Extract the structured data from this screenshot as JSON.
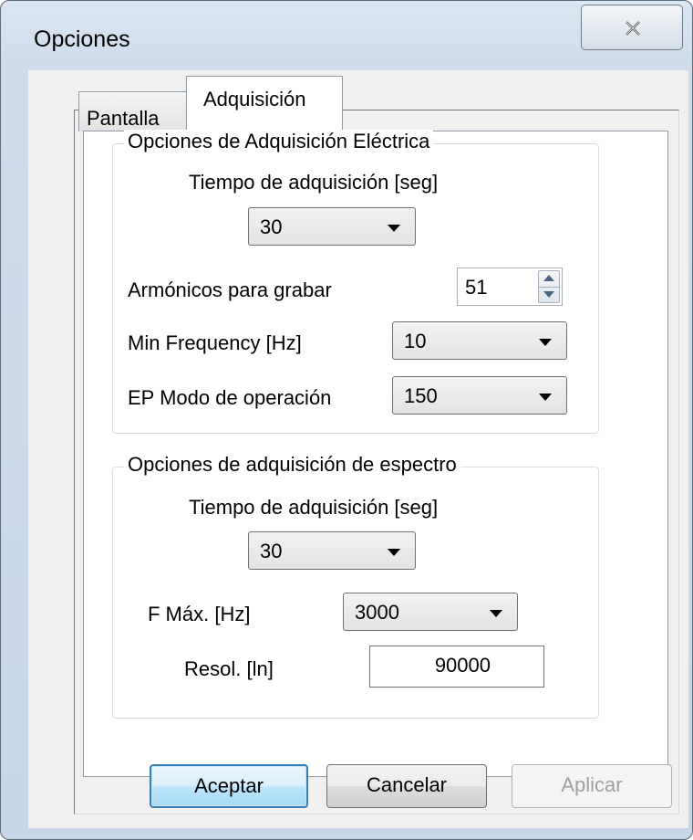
{
  "window": {
    "title": "Opciones",
    "close_icon": "close-icon"
  },
  "tabs": [
    {
      "label": "Pantalla",
      "selected": false
    },
    {
      "label": "Adquisición",
      "selected": true
    }
  ],
  "electrical_group": {
    "legend": "Opciones de Adquisición Eléctrica",
    "acq_time_label": "Tiempo de adquisición [seg]",
    "acq_time_value": "30",
    "harmonics_label": "Armónicos para grabar",
    "harmonics_value": "51",
    "min_freq_label": "Min Frequency [Hz]",
    "min_freq_value": "10",
    "ep_mode_label": "EP Modo de operación",
    "ep_mode_value": "150"
  },
  "spectrum_group": {
    "legend": "Opciones de adquisición de espectro",
    "acq_time_label": "Tiempo de adquisición [seg]",
    "acq_time_value": "30",
    "fmax_label": "F Máx. [Hz]",
    "fmax_value": "3000",
    "resol_label": "Resol. [ln]",
    "resol_value": "90000"
  },
  "buttons": {
    "accept": "Aceptar",
    "cancel": "Cancelar",
    "apply": "Aplicar"
  },
  "colors": {
    "frame": "#cfdcec",
    "default_button_border": "#3c7fb1",
    "disabled_text": "#a0a0a0"
  }
}
